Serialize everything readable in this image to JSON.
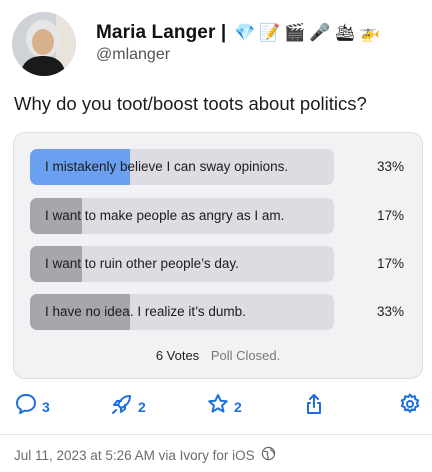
{
  "post": {
    "display_name": "Maria Langer |",
    "emojis": [
      "💎",
      "📝",
      "🎬",
      "🎤",
      "🛳",
      "🚁"
    ],
    "handle": "@mlanger",
    "text": "Why do you toot/boost toots about politics?"
  },
  "poll": {
    "options": [
      {
        "label": "I mistakenly believe I can sway opinions.",
        "percent": "33%",
        "fraction": 0.33,
        "leading": true
      },
      {
        "label": "I want to make people as angry as I am.",
        "percent": "17%",
        "fraction": 0.17,
        "leading": false
      },
      {
        "label": "I want to ruin other people’s day.",
        "percent": "17%",
        "fraction": 0.17,
        "leading": false
      },
      {
        "label": "I have no idea. I realize it’s dumb.",
        "percent": "33%",
        "fraction": 0.33,
        "leading": false
      }
    ],
    "votes": "6 Votes",
    "status": "Poll Closed."
  },
  "actions": {
    "reply_count": "3",
    "boost_count": "2",
    "favorite_count": "2"
  },
  "meta": {
    "timestamp": "Jul 11, 2023 at 5:26 AM via Ivory for iOS",
    "visibility_icon": "globe-icon"
  },
  "colors": {
    "accent": "#1d6fe0",
    "leading_fill": "#6b9ff0",
    "other_fill": "#a6a6ad",
    "track": "#dcdce2"
  }
}
